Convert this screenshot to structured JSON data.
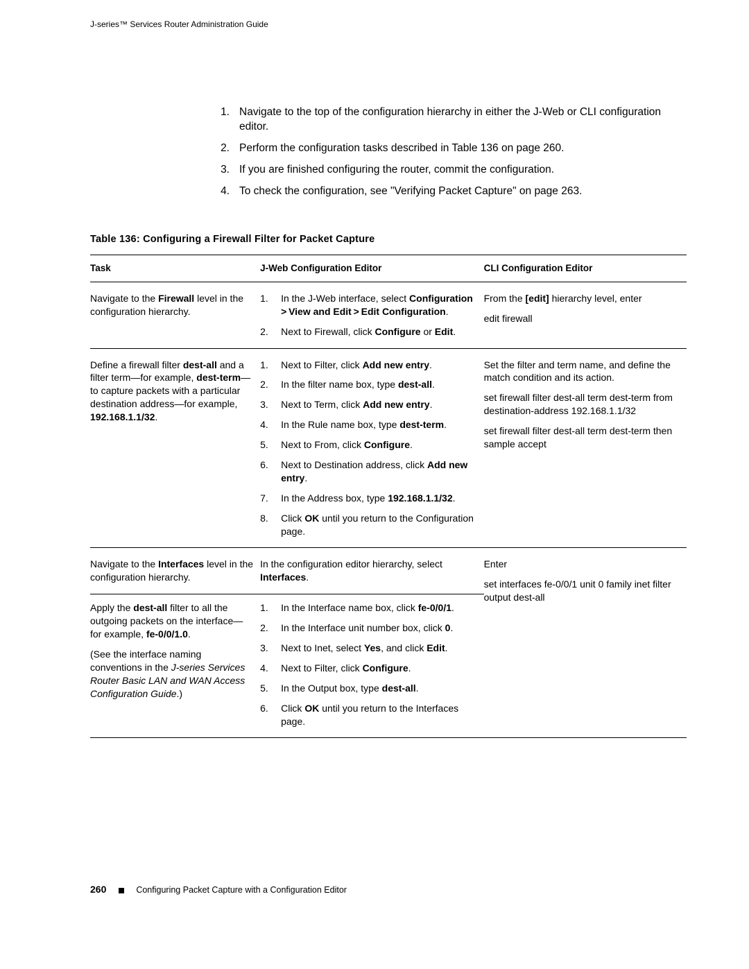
{
  "running_head": "J-series™ Services Router Administration Guide",
  "intro_steps": [
    "Navigate to the top of the configuration hierarchy in either the J-Web or CLI configuration editor.",
    "Perform the configuration tasks described in Table 136 on page 260.",
    "If you are finished configuring the router, commit the configuration.",
    "To check the configuration, see \"Verifying Packet Capture\" on page 263."
  ],
  "table_title": "Table 136: Configuring a Firewall Filter for Packet Capture",
  "columns": {
    "task": "Task",
    "jweb": "J-Web Configuration Editor",
    "cli": "CLI Configuration Editor"
  },
  "rows": {
    "r1": {
      "task_pre": "Navigate to the ",
      "task_bold": "Firewall",
      "task_post": " level in the configuration hierarchy.",
      "jweb": [
        {
          "pre": "In the J-Web interface, select ",
          "bold": "Configuration > View and Edit > Edit Configuration",
          "post": "."
        },
        {
          "pre": "Next to Firewall, click ",
          "bold": "Configure",
          "mid": " or ",
          "bold2": "Edit",
          "post": "."
        }
      ],
      "cli_line1_pre": "From the ",
      "cli_line1_bold": "[edit]",
      "cli_line1_post": " hierarchy level, enter",
      "cli_cmd": "edit firewall"
    },
    "r2": {
      "task_p1_a": "Define a firewall filter ",
      "task_p1_b": "dest-all",
      "task_p1_c": " and a filter term—for example, ",
      "task_p1_d": "dest-term",
      "task_p1_e": "—to capture packets with a particular destination address—for example, ",
      "task_p1_f": "192.168.1.1/32",
      "task_p1_g": ".",
      "jweb": [
        {
          "pre": "Next to Filter, click ",
          "bold": "Add new entry",
          "post": "."
        },
        {
          "pre": "In the filter name box, type ",
          "bold": "dest-all",
          "post": "."
        },
        {
          "pre": "Next to Term, click ",
          "bold": "Add new entry",
          "post": "."
        },
        {
          "pre": "In the Rule name box, type ",
          "bold": "dest-term",
          "post": "."
        },
        {
          "pre": "Next to From, click ",
          "bold": "Configure",
          "post": "."
        },
        {
          "pre": "Next to Destination address, click ",
          "bold": "Add new entry",
          "post": "."
        },
        {
          "pre": "In the Address box, type ",
          "bold": "192.168.1.1/32",
          "post": "."
        },
        {
          "pre": "Click ",
          "bold": "OK",
          "post": " until you return to the Configuration page."
        }
      ],
      "cli_p1": "Set the filter and term name, and define the match condition and its action.",
      "cli_p2": "set firewall filter dest-all term dest-term from destination-address 192.168.1.1/32",
      "cli_p3": "set firewall filter dest-all term dest-term then sample accept"
    },
    "r3": {
      "task_pre": "Navigate to the ",
      "task_bold": "Interfaces",
      "task_post": " level in the configuration hierarchy.",
      "jweb_pre": "In the configuration editor hierarchy, select ",
      "jweb_bold": "Interfaces",
      "jweb_post": ".",
      "cli": "Enter"
    },
    "r4": {
      "task_p1_a": "Apply the ",
      "task_p1_b": "dest-all",
      "task_p1_c": " filter to all the outgoing packets on the interface—for example, ",
      "task_p1_d": "fe-0/0/1.0",
      "task_p1_e": ".",
      "task_p2_a": "(See the interface naming conventions in the ",
      "task_p2_ital": "J-series Services Router Basic LAN and WAN Access Configuration Guide",
      "task_p2_c": ".)",
      "jweb": [
        {
          "pre": "In the Interface name box, click ",
          "bold": "fe-0/0/1",
          "post": "."
        },
        {
          "pre": "In the Interface unit number box, click ",
          "bold": "0",
          "post": "."
        },
        {
          "pre": "Next to Inet, select ",
          "bold": "Yes",
          "mid": ", and click ",
          "bold2": "Edit",
          "post": "."
        },
        {
          "pre": "Next to Filter, click ",
          "bold": "Configure",
          "post": "."
        },
        {
          "pre": "In the Output box, type ",
          "bold": "dest-all",
          "post": "."
        },
        {
          "pre": "Click ",
          "bold": "OK",
          "post": " until you return to the Interfaces page."
        }
      ],
      "cli": "set interfaces fe-0/0/1 unit 0 family inet filter output dest-all"
    }
  },
  "footer": {
    "page": "260",
    "section": "Configuring Packet Capture with a Configuration Editor"
  }
}
